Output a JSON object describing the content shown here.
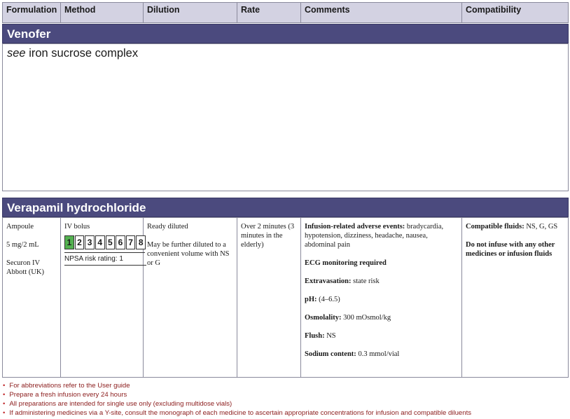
{
  "header": {
    "columns": [
      "Formulation",
      "Method",
      "Dilution",
      "Rate",
      "Comments",
      "Compatibility"
    ]
  },
  "venofer": {
    "title": "Venofer",
    "see_word": "see",
    "see_target": " iron sucrose complex"
  },
  "verapamil": {
    "title": "Verapamil hydrochloride",
    "formulation": [
      "Ampoule",
      "5 mg/2 mL",
      "Securon IV",
      "Abbott (UK)"
    ],
    "method": {
      "label": "IV bolus",
      "risk_numbers": [
        "1",
        "2",
        "3",
        "4",
        "5",
        "6",
        "7",
        "8"
      ],
      "risk_rating_value": 1,
      "risk_label": "NPSA risk rating: 1"
    },
    "dilution": [
      "Ready diluted",
      "May be further diluted to a convenient volume with NS or G"
    ],
    "rate": "Over 2 minutes (3 minutes in the elderly)",
    "comments": [
      {
        "label": "Infusion-related adverse events:",
        "text": " bradycardia, hypotension, dizziness, headache, nausea, abdominal pain"
      },
      {
        "label": "ECG monitoring required",
        "text": ""
      },
      {
        "label": "Extravasation:",
        "text": " state risk"
      },
      {
        "label": "pH:",
        "text": " (4–6.5)"
      },
      {
        "label": "Osmolality:",
        "text": " 300 mOsmol/kg"
      },
      {
        "label": "Flush:",
        "text": " NS"
      },
      {
        "label": "Sodium content:",
        "text": " 0.3 mmol/vial"
      }
    ],
    "compatibility": [
      {
        "label": "Compatible fluids:",
        "text": " NS, G, GS"
      },
      {
        "label": "Do not infuse with any other medicines or infusion fluids",
        "text": ""
      }
    ]
  },
  "footnotes": [
    "For abbreviations refer to the User guide",
    "Prepare a fresh infusion every 24 hours",
    "All preparations are intended for single use only (excluding multidose vials)",
    "If administering medicines via a Y-site, consult the monograph of each medicine to ascertain appropriate concentrations for infusion and compatible diluents"
  ],
  "colors": {
    "header_bg": "#d3d2e2",
    "section_bar": "#4b4a7e",
    "risk_active": "#53b150",
    "footnote_text": "#8b1c1c"
  }
}
